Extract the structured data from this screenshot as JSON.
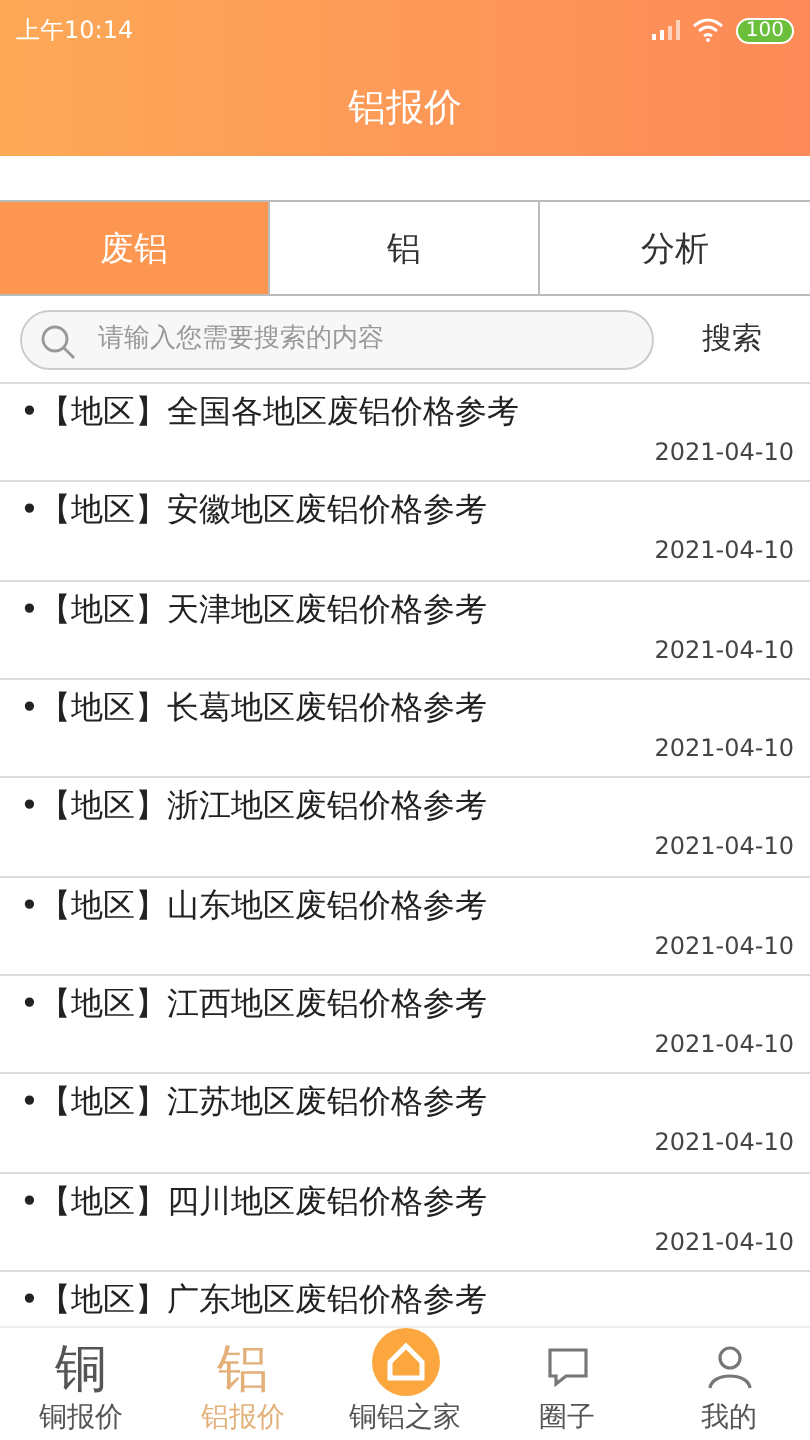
{
  "status_bar": {
    "time": "上午10:14",
    "battery": "100"
  },
  "header": {
    "title": "铝报价"
  },
  "tabs": [
    {
      "label": "废铝",
      "selected": true
    },
    {
      "label": "铝",
      "selected": false
    },
    {
      "label": "分析",
      "selected": false
    }
  ],
  "search": {
    "placeholder": "请输入您需要搜索的内容",
    "button": "搜索"
  },
  "list": [
    {
      "title": "•【地区】全国各地区废铝价格参考",
      "date": "2021-04-10"
    },
    {
      "title": "•【地区】安徽地区废铝价格参考",
      "date": "2021-04-10"
    },
    {
      "title": "•【地区】天津地区废铝价格参考",
      "date": "2021-04-10"
    },
    {
      "title": "•【地区】长葛地区废铝价格参考",
      "date": "2021-04-10"
    },
    {
      "title": "•【地区】浙江地区废铝价格参考",
      "date": "2021-04-10"
    },
    {
      "title": "•【地区】山东地区废铝价格参考",
      "date": "2021-04-10"
    },
    {
      "title": "•【地区】江西地区废铝价格参考",
      "date": "2021-04-10"
    },
    {
      "title": "•【地区】江苏地区废铝价格参考",
      "date": "2021-04-10"
    },
    {
      "title": "•【地区】四川地区废铝价格参考",
      "date": "2021-04-10"
    },
    {
      "title": "•【地区】广东地区废铝价格参考"
    }
  ],
  "nav": [
    {
      "kind": "glyph",
      "glyph": "铜",
      "label": "铜报价",
      "selected": false
    },
    {
      "kind": "glyph",
      "glyph": "铝",
      "label": "铝报价",
      "selected": true
    },
    {
      "kind": "home",
      "label": "铜铝之家",
      "selected": false
    },
    {
      "kind": "chat",
      "label": "圈子",
      "selected": false
    },
    {
      "kind": "user",
      "label": "我的",
      "selected": false
    }
  ]
}
